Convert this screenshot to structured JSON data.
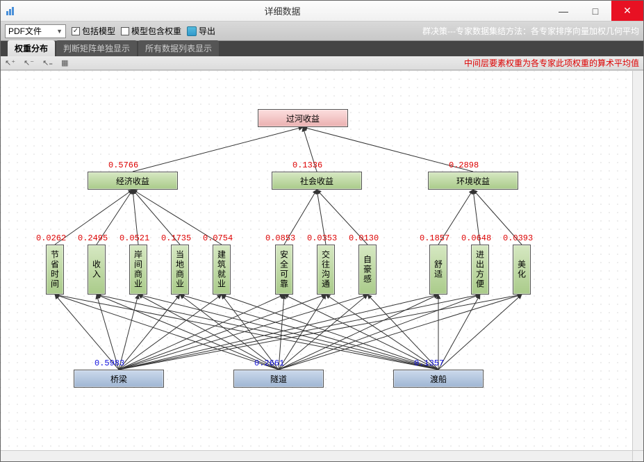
{
  "window": {
    "title": "详细数据"
  },
  "toolbar": {
    "combo_label": "PDF文件",
    "chk1": "包括模型",
    "chk2": "模型包含权重",
    "export": "导出",
    "right_note": "群决策---专家数据集结方法：各专家排序向量加权几何平均"
  },
  "tabs": {
    "t1": "权重分布",
    "t2": "判断矩阵单独显示",
    "t3": "所有数据列表显示"
  },
  "subbar": {
    "note": "中间层要素权重为各专家此项权重的算术平均值"
  },
  "nodes": {
    "root": "过河收益",
    "mid": [
      {
        "label": "经济收益",
        "w": "0.5766"
      },
      {
        "label": "社会收益",
        "w": "0.1336"
      },
      {
        "label": "环境收益",
        "w": "0.2898"
      }
    ],
    "leaf": [
      {
        "label": "节省时间",
        "w": "0.0262"
      },
      {
        "label": "收入",
        "w": "0.2495"
      },
      {
        "label": "岸间商业",
        "w": "0.0521"
      },
      {
        "label": "当地商业",
        "w": "0.1735"
      },
      {
        "label": "建筑就业",
        "w": "0.0754"
      },
      {
        "label": "安全可靠",
        "w": "0.0853"
      },
      {
        "label": "交往沟通",
        "w": "0.0353"
      },
      {
        "label": "自豪感",
        "w": "0.0130"
      },
      {
        "label": "舒适",
        "w": "0.1857"
      },
      {
        "label": "进出方便",
        "w": "0.0648"
      },
      {
        "label": "美化",
        "w": "0.0393"
      }
    ],
    "alt": [
      {
        "label": "桥梁",
        "w": "0.5983"
      },
      {
        "label": "隧道",
        "w": "0.2661"
      },
      {
        "label": "渡船",
        "w": "0.1357"
      }
    ]
  },
  "chart_data": {
    "type": "hierarchy",
    "title": "过河收益",
    "levels": [
      {
        "name": "goal",
        "nodes": [
          "过河收益"
        ]
      },
      {
        "name": "criteria",
        "nodes": [
          "经济收益",
          "社会收益",
          "环境收益"
        ],
        "weights": [
          0.5766,
          0.1336,
          0.2898
        ]
      },
      {
        "name": "subcriteria",
        "nodes": [
          "节省时间",
          "收入",
          "岸间商业",
          "当地商业",
          "建筑就业",
          "安全可靠",
          "交往沟通",
          "自豪感",
          "舒适",
          "进出方便",
          "美化"
        ],
        "weights": [
          0.0262,
          0.2495,
          0.0521,
          0.1735,
          0.0754,
          0.0853,
          0.0353,
          0.013,
          0.1857,
          0.0648,
          0.0393
        ],
        "parent": [
          "经济收益",
          "经济收益",
          "经济收益",
          "经济收益",
          "经济收益",
          "社会收益",
          "社会收益",
          "社会收益",
          "环境收益",
          "环境收益",
          "环境收益"
        ]
      },
      {
        "name": "alternatives",
        "nodes": [
          "桥梁",
          "隧道",
          "渡船"
        ],
        "weights": [
          0.5983,
          0.2661,
          0.1357
        ]
      }
    ],
    "edges_note": "each alternative connects to all subcriteria; each subcriterion connects to its parent criterion; each criterion connects to the goal"
  }
}
